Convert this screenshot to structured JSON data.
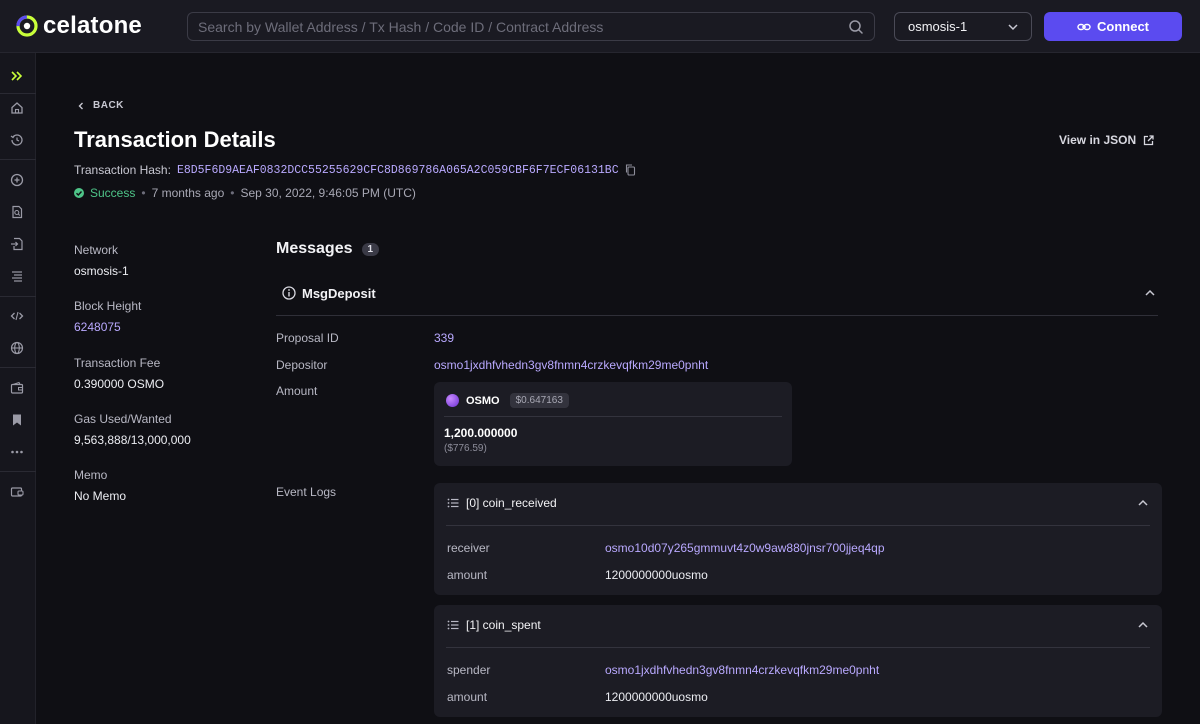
{
  "header": {
    "logo_text": "celatone",
    "search_placeholder": "Search by Wallet Address / Tx Hash / Code ID / Contract Address",
    "network": "osmosis-1",
    "connect_label": "Connect"
  },
  "colors": {
    "accent": "#5b4bf0",
    "link": "#b9a9ff",
    "success": "#4ec488",
    "background": "#0f0f14",
    "card": "#1c1c24"
  },
  "sidebar": {
    "icons": [
      "chevrons-right-icon",
      "home-icon",
      "history-icon",
      "plus-circle-icon",
      "search-doc-icon",
      "file-import-icon",
      "list-icon",
      "code-icon",
      "globe-icon",
      "wallet-icon",
      "bookmark-icon",
      "more-icon",
      "card-icon"
    ]
  },
  "page": {
    "back_label": "BACK",
    "title": "Transaction Details",
    "view_json_label": "View in JSON",
    "hash_label": "Transaction Hash:",
    "hash_value": "E8D5F6D9AEAF0832DCC55255629CFC8D869786A065A2C059CBF6F7ECF06131BC",
    "status": "Success",
    "relative_time": "7 months ago",
    "timestamp": "Sep 30, 2022, 9:46:05 PM (UTC)"
  },
  "info": {
    "network_label": "Network",
    "network_value": "osmosis-1",
    "block_label": "Block Height",
    "block_value": "6248075",
    "fee_label": "Transaction Fee",
    "fee_value": "0.390000 OSMO",
    "gas_label": "Gas Used/Wanted",
    "gas_value": "9,563,888/13,000,000",
    "memo_label": "Memo",
    "memo_value": "No Memo"
  },
  "messages": {
    "title": "Messages",
    "count": "1",
    "msg_type": "MsgDeposit",
    "proposal_label": "Proposal ID",
    "proposal_value": "339",
    "depositor_label": "Depositor",
    "depositor_value": "osmo1jxdhfvhedn3gv8fnmn4crzkevqfkm29me0pnht",
    "amount_label": "Amount",
    "token_name": "OSMO",
    "token_price": "$0.647163",
    "token_amount": "1,200.000000",
    "token_usd": "($776.59)",
    "event_logs_label": "Event Logs"
  },
  "events": [
    {
      "title": "[0] coin_received",
      "rows": [
        {
          "label": "receiver",
          "value": "osmo10d07y265gmmuvt4z0w9aw880jnsr700jjeq4qp"
        },
        {
          "label": "amount",
          "value": "1200000000uosmo"
        }
      ]
    },
    {
      "title": "[1] coin_spent",
      "rows": [
        {
          "label": "spender",
          "value": "osmo1jxdhfvhedn3gv8fnmn4crzkevqfkm29me0pnht"
        },
        {
          "label": "amount",
          "value": "1200000000uosmo"
        }
      ]
    }
  ]
}
